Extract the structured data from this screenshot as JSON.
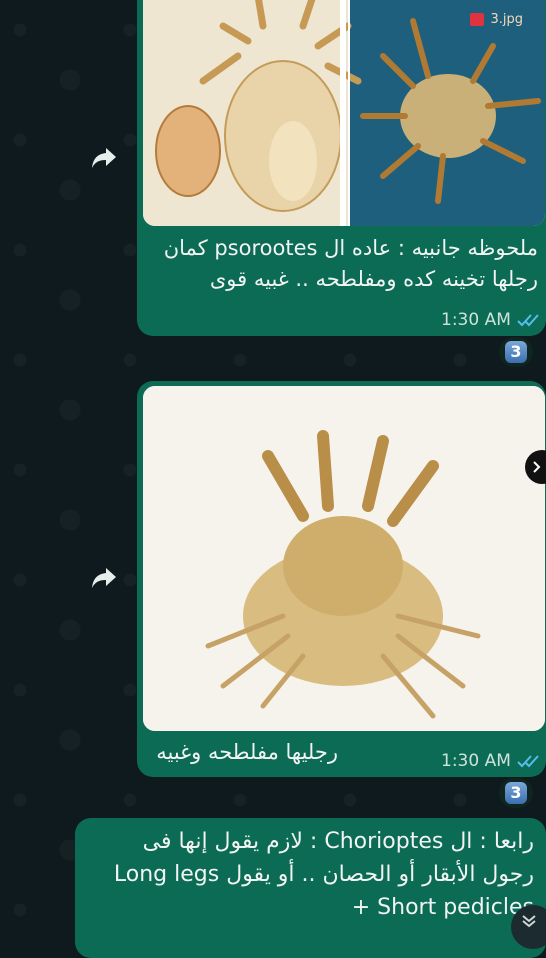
{
  "messages": [
    {
      "image_label": "3.jpg",
      "text": "ملحوظه جانبيه : عاده ال psorootes كمان رجلها تخينه كده ومفلطحه .. غبيه قوى",
      "time": "1:30 AM",
      "reaction": "3"
    },
    {
      "text": "رجليها مفلطحه وغبيه",
      "time": "1:30 AM",
      "reaction": "3"
    },
    {
      "text": "رابعا : ال Chorioptes : لازم يقول إنها فى رجول الأبقار أو الحصان .. أو يقول Long legs + Short pedicles"
    }
  ],
  "colors": {
    "bubble": "#0b6b55",
    "background": "#0e1a1d"
  }
}
